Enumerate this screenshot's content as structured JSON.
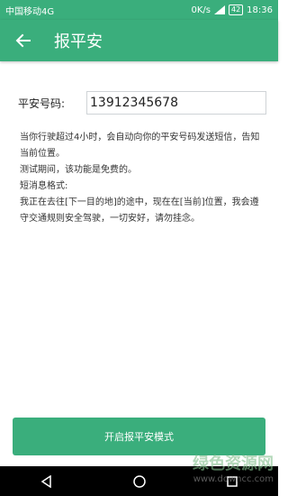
{
  "status_bar": {
    "carrier": "中国移动4G",
    "network_speed": "0K/s",
    "battery": "42",
    "time": "18:36"
  },
  "app_bar": {
    "back_icon": "arrow-left-icon",
    "title": "报平安"
  },
  "form": {
    "phone_label": "平安号码:",
    "phone_value": "13912345678"
  },
  "info": {
    "line1": "当你行驶超过4小时，会自动向你的平安号码发送短信，告知当前位置。",
    "line2": "测试期间，该功能是免费的。",
    "line3": "短消息格式:",
    "line4": "我正在去往[下一目的地]的途中，现在在[当前]位置，我会遵守交通规则安全驾驶，一切安好，请勿挂念。"
  },
  "primary_button": {
    "label": "开启报平安模式"
  },
  "nav_bar": {
    "icons": [
      "back-triangle-icon",
      "home-circle-icon",
      "recents-square-icon"
    ]
  },
  "watermark": {
    "title": "绿色资源网",
    "url": "www.downcc.com"
  },
  "colors": {
    "primary": "#3aae7c",
    "navbar": "#000000"
  }
}
